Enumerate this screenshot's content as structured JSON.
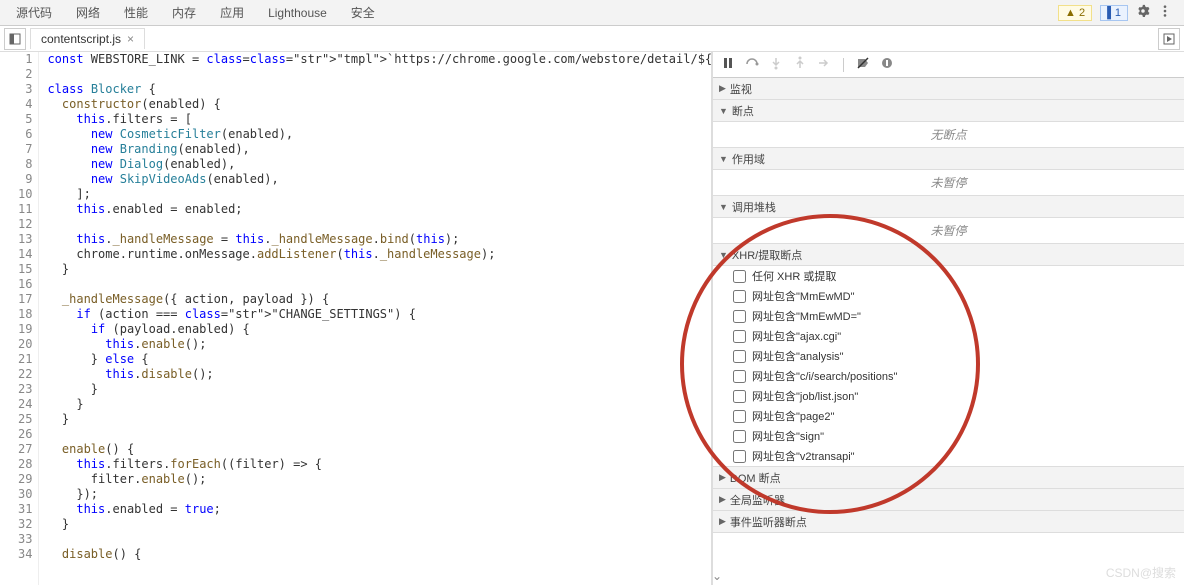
{
  "topbar": {
    "tabs": [
      "源代码",
      "网络",
      "性能",
      "内存",
      "应用",
      "Lighthouse",
      "安全"
    ],
    "warn_count": "2",
    "msg_count": "1"
  },
  "filebar": {
    "file": "contentscript.js"
  },
  "code": {
    "lines": [
      {
        "n": 1,
        "t": "const WEBSTORE_LINK = `https://chrome.google.com/webstore/detail/${chrome.runtime.id}`;"
      },
      {
        "n": 2,
        "t": ""
      },
      {
        "n": 3,
        "t": "class Blocker {"
      },
      {
        "n": 4,
        "t": "  constructor(enabled) {"
      },
      {
        "n": 5,
        "t": "    this.filters = ["
      },
      {
        "n": 6,
        "t": "      new CosmeticFilter(enabled),"
      },
      {
        "n": 7,
        "t": "      new Branding(enabled),"
      },
      {
        "n": 8,
        "t": "      new Dialog(enabled),"
      },
      {
        "n": 9,
        "t": "      new SkipVideoAds(enabled),"
      },
      {
        "n": 10,
        "t": "    ];"
      },
      {
        "n": 11,
        "t": "    this.enabled = enabled;"
      },
      {
        "n": 12,
        "t": ""
      },
      {
        "n": 13,
        "t": "    this._handleMessage = this._handleMessage.bind(this);"
      },
      {
        "n": 14,
        "t": "    chrome.runtime.onMessage.addListener(this._handleMessage);"
      },
      {
        "n": 15,
        "t": "  }"
      },
      {
        "n": 16,
        "t": ""
      },
      {
        "n": 17,
        "t": "  _handleMessage({ action, payload }) {"
      },
      {
        "n": 18,
        "t": "    if (action === \"CHANGE_SETTINGS\") {"
      },
      {
        "n": 19,
        "t": "      if (payload.enabled) {"
      },
      {
        "n": 20,
        "t": "        this.enable();"
      },
      {
        "n": 21,
        "t": "      } else {"
      },
      {
        "n": 22,
        "t": "        this.disable();"
      },
      {
        "n": 23,
        "t": "      }"
      },
      {
        "n": 24,
        "t": "    }"
      },
      {
        "n": 25,
        "t": "  }"
      },
      {
        "n": 26,
        "t": ""
      },
      {
        "n": 27,
        "t": "  enable() {"
      },
      {
        "n": 28,
        "t": "    this.filters.forEach((filter) => {"
      },
      {
        "n": 29,
        "t": "      filter.enable();"
      },
      {
        "n": 30,
        "t": "    });"
      },
      {
        "n": 31,
        "t": "    this.enabled = true;"
      },
      {
        "n": 32,
        "t": "  }"
      },
      {
        "n": 33,
        "t": ""
      },
      {
        "n": 34,
        "t": "  disable() {"
      }
    ]
  },
  "sections": {
    "watch": "监视",
    "breakpoints": "断点",
    "no_breakpoints": "无断点",
    "scope": "作用域",
    "not_paused": "未暂停",
    "callstack": "调用堆栈",
    "xhr": "XHR/提取断点",
    "dom": "DOM 断点",
    "global": "全局监听器",
    "event": "事件监听器断点"
  },
  "xhr_bps": [
    "任何 XHR 或提取",
    "网址包含\"MmEwMD\"",
    "网址包含\"MmEwMD=\"",
    "网址包含\"ajax.cgi\"",
    "网址包含\"analysis\"",
    "网址包含\"c/i/search/positions\"",
    "网址包含\"job/list.json\"",
    "网址包含\"page2\"",
    "网址包含\"sign\"",
    "网址包含\"v2transapi\""
  ],
  "watermark": "CSDN@搜索"
}
